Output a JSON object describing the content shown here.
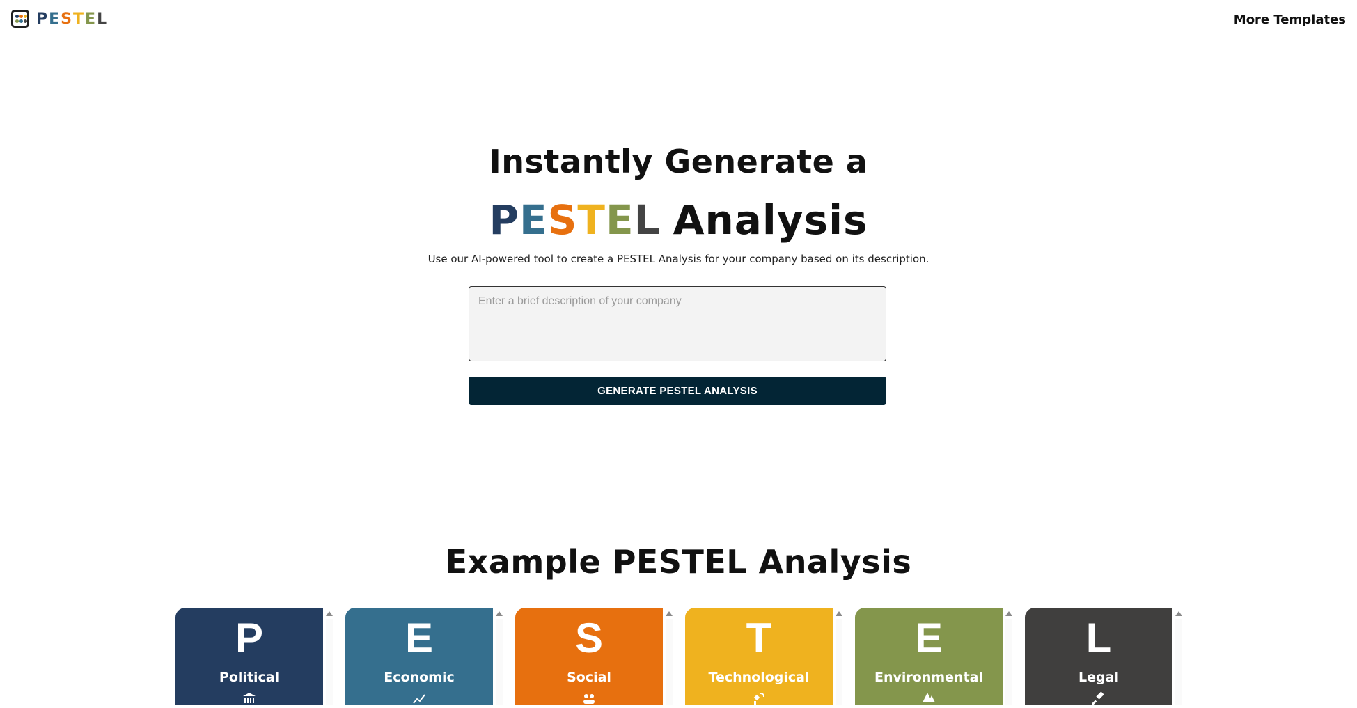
{
  "header": {
    "logo_letters": [
      {
        "char": "P",
        "color": "#243d60"
      },
      {
        "char": "E",
        "color": "#356f8e"
      },
      {
        "char": "S",
        "color": "#e7700f"
      },
      {
        "char": "T",
        "color": "#efb21f"
      },
      {
        "char": "E",
        "color": "#84964c"
      },
      {
        "char": "L",
        "color": "#444444"
      }
    ],
    "logo_dot_colors": [
      "#243d60",
      "#e7700f",
      "#efb21f",
      "#84964c",
      "#356f8e",
      "#444444"
    ],
    "more_templates_label": "More Templates"
  },
  "hero": {
    "line1": "Instantly Generate a",
    "line2_word": "Analysis",
    "subtitle": "Use our AI-powered tool to create a PESTEL Analysis for your company based on its description.",
    "input_placeholder": "Enter a brief description of your company",
    "input_value": "",
    "generate_button_label": "GENERATE PESTEL ANALYSIS"
  },
  "examples": {
    "title": "Example PESTEL Analysis",
    "cards": [
      {
        "letter": "P",
        "name": "Political",
        "color": "#243d60",
        "icon": "government-building-icon"
      },
      {
        "letter": "E",
        "name": "Economic",
        "color": "#356f8e",
        "icon": "trend-chart-icon"
      },
      {
        "letter": "S",
        "name": "Social",
        "color": "#e7700f",
        "icon": "people-icon"
      },
      {
        "letter": "T",
        "name": "Technological",
        "color": "#efb21f",
        "icon": "satellite-icon"
      },
      {
        "letter": "E",
        "name": "Environmental",
        "color": "#84964c",
        "icon": "tree-icon"
      },
      {
        "letter": "L",
        "name": "Legal",
        "color": "#403f3e",
        "icon": "gavel-icon"
      }
    ]
  },
  "colors": {
    "button_bg": "#032535",
    "input_bg": "#f3f3f3"
  }
}
